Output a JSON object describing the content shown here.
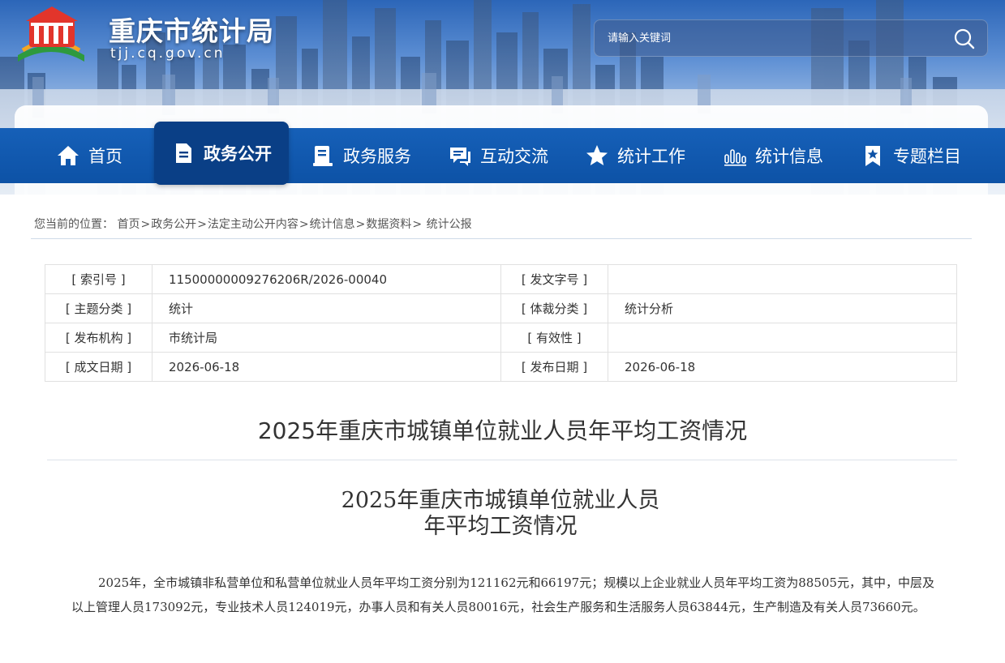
{
  "site": {
    "name": "重庆市统计局",
    "domain": "tjj.cq.gov.cn"
  },
  "search": {
    "placeholder": "请输入关键词"
  },
  "nav": {
    "items": [
      {
        "label": "首页",
        "icon": "home-icon"
      },
      {
        "label": "政务公开",
        "icon": "document-icon",
        "active": true
      },
      {
        "label": "政务服务",
        "icon": "service-icon"
      },
      {
        "label": "互动交流",
        "icon": "chat-icon"
      },
      {
        "label": "统计工作",
        "icon": "star-icon"
      },
      {
        "label": "统计信息",
        "icon": "bar-chart-icon"
      },
      {
        "label": "专题栏目",
        "icon": "bookmark-icon"
      }
    ]
  },
  "breadcrumb": {
    "prefix": "您当前的位置：",
    "items": [
      "首页",
      "政务公开",
      "法定主动公开内容",
      "统计信息",
      "数据资料",
      "统计公报"
    ],
    "separator": ">"
  },
  "meta": {
    "rows": [
      {
        "label1": "[ 索引号 ]",
        "value1": "11500000009276206R/2026-00040",
        "label2": "[ 发文字号 ]",
        "value2": ""
      },
      {
        "label1": "[ 主题分类 ]",
        "value1": "统计",
        "label2": "[ 体裁分类 ]",
        "value2": "统计分析"
      },
      {
        "label1": "[ 发布机构 ]",
        "value1": "市统计局",
        "label2": "[ 有效性 ]",
        "value2": ""
      },
      {
        "label1": "[ 成文日期 ]",
        "value1": "2026-06-18",
        "label2": "[ 发布日期 ]",
        "value2": "2026-06-18"
      }
    ]
  },
  "article": {
    "title": "2025年重庆市城镇单位就业人员年平均工资情况",
    "subtitle_line1": "2025年重庆市城镇单位就业人员",
    "subtitle_line2": "年平均工资情况",
    "paragraph": "2025年，全市城镇非私营单位和私营单位就业人员年平均工资分别为121162元和66197元；规模以上企业就业人员年平均工资为88505元，其中，中层及以上管理人员173092元，专业技术人员124019元，办事人员和有关人员80016元，社会生产服务和生活服务人员63844元，生产制造及有关人员73660元。"
  },
  "colors": {
    "nav_bg": "#0d52a6",
    "nav_active": "#0a3f86",
    "text": "#333333"
  }
}
